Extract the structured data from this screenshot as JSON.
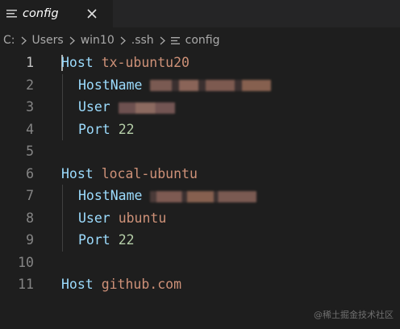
{
  "tab": {
    "label": "config",
    "icon": "menu-lines-icon",
    "close_icon": "close-icon"
  },
  "breadcrumb": {
    "items": [
      "C:",
      "Users",
      "win10",
      ".ssh",
      "config"
    ],
    "separator_icon": "chevron-right-icon",
    "file_icon": "menu-lines-icon"
  },
  "editor": {
    "lines": [
      {
        "number": "1",
        "keyword": "Host",
        "value": "tx-ubuntu20"
      },
      {
        "number": "2",
        "keyword": "HostName",
        "value": ""
      },
      {
        "number": "3",
        "keyword": "User",
        "value": ""
      },
      {
        "number": "4",
        "keyword": "Port",
        "value": "22"
      },
      {
        "number": "5",
        "keyword": "",
        "value": ""
      },
      {
        "number": "6",
        "keyword": "Host",
        "value": "local-ubuntu"
      },
      {
        "number": "7",
        "keyword": "HostName",
        "value": ""
      },
      {
        "number": "8",
        "keyword": "User",
        "value": "ubuntu"
      },
      {
        "number": "9",
        "keyword": "Port",
        "value": "22"
      },
      {
        "number": "10",
        "keyword": "",
        "value": ""
      },
      {
        "number": "11",
        "keyword": "Host",
        "value": "github.com"
      }
    ]
  },
  "watermark": "@稀土掘金技术社区",
  "colors": {
    "keyword": "#9cdcfe",
    "string": "#ce9178",
    "number": "#b5cea8",
    "line_number": "#858585"
  }
}
